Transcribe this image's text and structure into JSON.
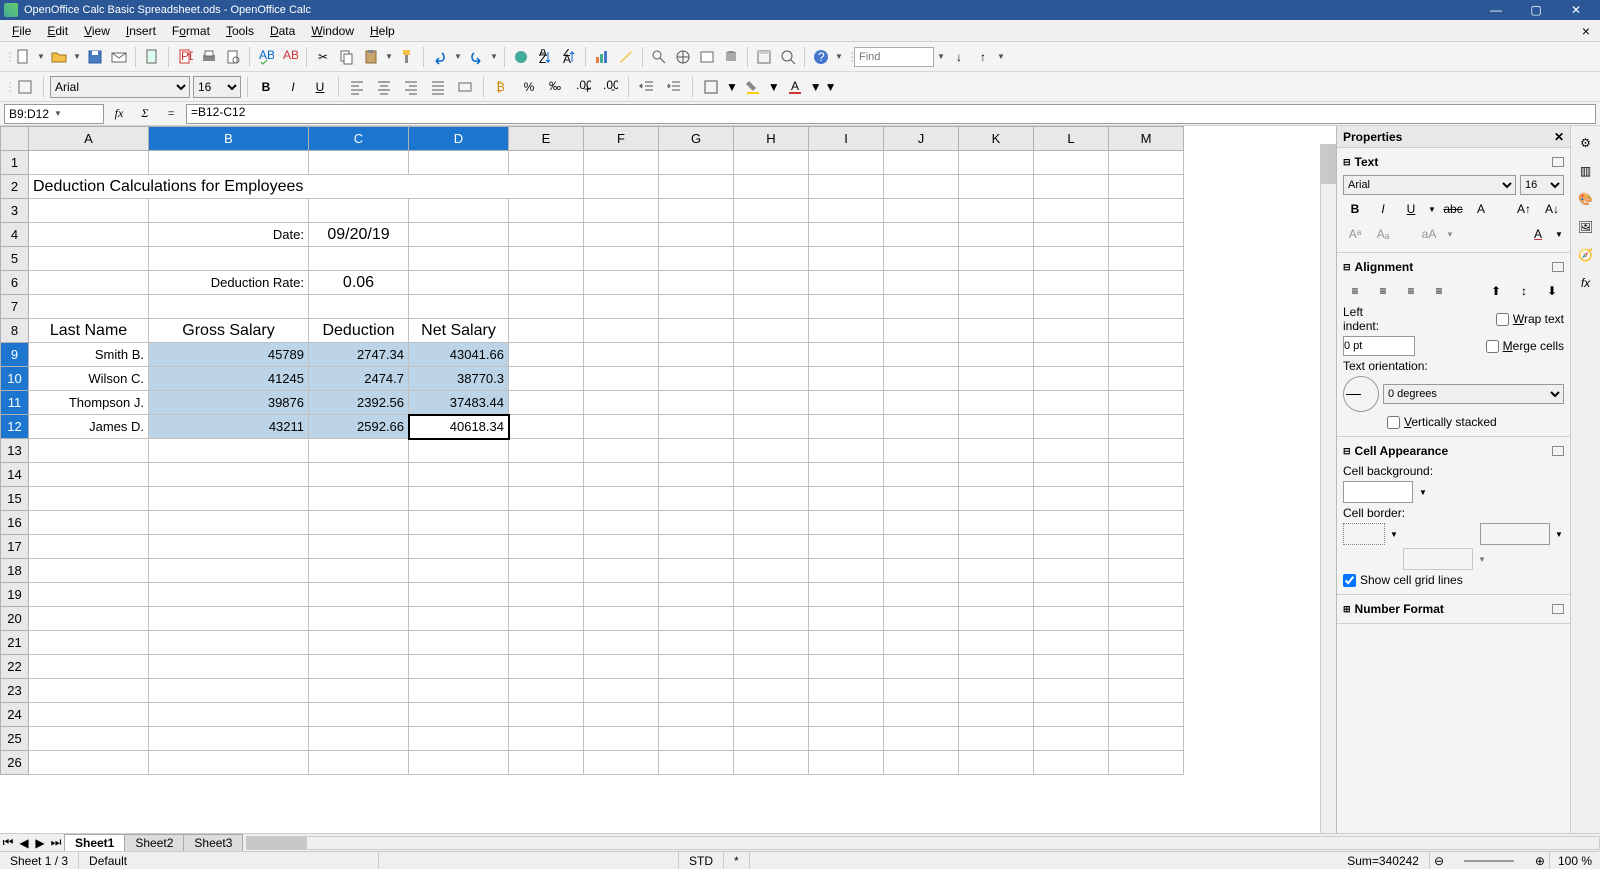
{
  "window": {
    "title": "OpenOffice Calc Basic Spreadsheet.ods - OpenOffice Calc"
  },
  "menu": {
    "file": "File",
    "edit": "Edit",
    "view": "View",
    "insert": "Insert",
    "format": "Format",
    "tools": "Tools",
    "data": "Data",
    "window": "Window",
    "help": "Help"
  },
  "toolbar": {
    "find_placeholder": "Find"
  },
  "format": {
    "font": "Arial",
    "size": "16"
  },
  "formula": {
    "name": "B9:D12",
    "value": "=B12-C12"
  },
  "columns": [
    "A",
    "B",
    "C",
    "D",
    "E",
    "F",
    "G",
    "H",
    "I",
    "J",
    "K",
    "L",
    "M"
  ],
  "rows": 26,
  "selected_cols": [
    "B",
    "C",
    "D"
  ],
  "selected_rows": [
    9,
    10,
    11,
    12
  ],
  "active_cell": "D12",
  "spreadsheet": {
    "title": "Deduction Calculations for Employees",
    "date_label": "Date:",
    "date_value": "09/20/19",
    "rate_label": "Deduction Rate:",
    "rate_value": "0.06",
    "headers": {
      "a": "Last Name",
      "b": "Gross Salary",
      "c": "Deduction",
      "d": "Net Salary"
    },
    "data": [
      {
        "name": "Smith B.",
        "gross": "45789",
        "ded": "2747.34",
        "net": "43041.66"
      },
      {
        "name": "Wilson C.",
        "gross": "41245",
        "ded": "2474.7",
        "net": "38770.3"
      },
      {
        "name": "Thompson J.",
        "gross": "39876",
        "ded": "2392.56",
        "net": "37483.44"
      },
      {
        "name": "James D.",
        "gross": "43211",
        "ded": "2592.66",
        "net": "40618.34"
      }
    ]
  },
  "sheets": {
    "s1": "Sheet1",
    "s2": "Sheet2",
    "s3": "Sheet3"
  },
  "status": {
    "sheet": "Sheet 1 / 3",
    "style": "Default",
    "mode": "STD",
    "star": "*",
    "sum": "Sum=340242",
    "zoom": "100 %"
  },
  "props": {
    "title": "Properties",
    "text": {
      "title": "Text",
      "font": "Arial",
      "size": "16"
    },
    "align": {
      "title": "Alignment",
      "indent_label": "Left indent:",
      "indent_val": "0 pt",
      "wrap": "Wrap text",
      "merge": "Merge cells",
      "orient_label": "Text orientation:",
      "orient_val": "0 degrees",
      "vstack": "Vertically stacked"
    },
    "appearance": {
      "title": "Cell Appearance",
      "bg_label": "Cell background:",
      "border_label": "Cell border:",
      "gridlines": "Show cell grid lines"
    },
    "numfmt": {
      "title": "Number Format"
    }
  }
}
